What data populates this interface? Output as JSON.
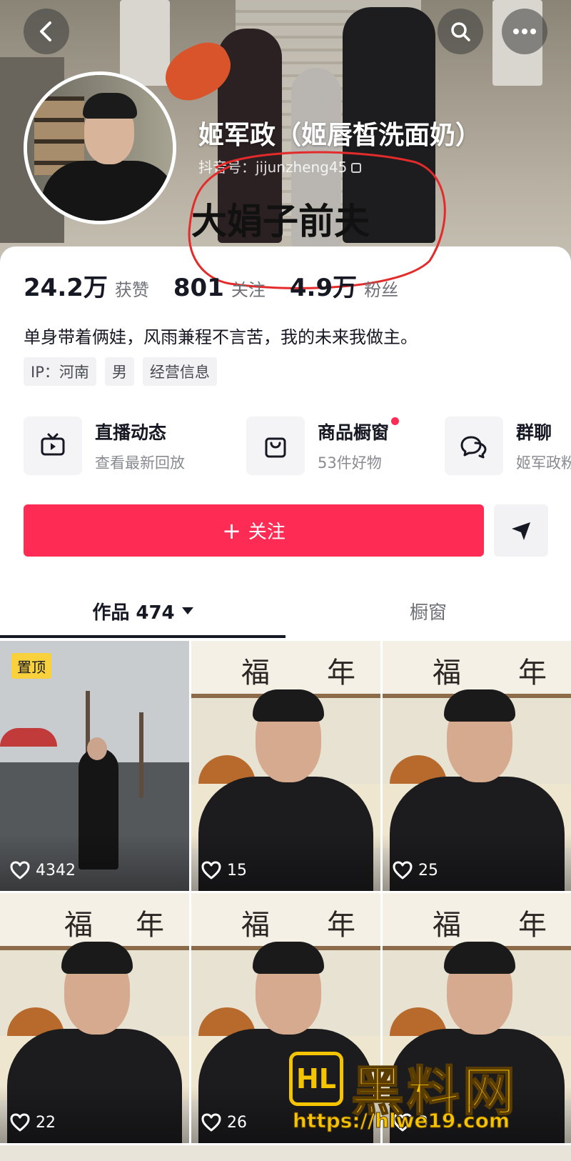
{
  "header": {
    "back_icon": "chevron-left-icon",
    "search_icon": "search-icon",
    "more_icon": "more-horizontal-icon",
    "username": "姬军政（姬唇皙洗面奶）",
    "douyin_id": "抖音号：jijunzheng45",
    "overlay_note": "大娟子前夫",
    "annotation_color": "#e32b2b"
  },
  "stats": [
    {
      "value": "24.2万",
      "label": "获赞"
    },
    {
      "value": "801",
      "label": "关注"
    },
    {
      "value": "4.9万",
      "label": "粉丝"
    }
  ],
  "bio": "单身带着俩娃，风雨兼程不言苦，我的未来我做主。",
  "tags": [
    "IP：河南",
    "男",
    "经营信息"
  ],
  "features": [
    {
      "title": "直播动态",
      "subtitle": "查看最新回放",
      "icon": "tv-play-icon"
    },
    {
      "title": "商品橱窗",
      "subtitle": "53件好物",
      "icon": "shopping-bag-icon",
      "badge": "red-dot"
    },
    {
      "title": "群聊",
      "subtitle": "姬军政粉",
      "icon": "chat-bubbles-icon"
    }
  ],
  "actions": {
    "follow_plus": "+",
    "follow_label": "关注",
    "share_icon": "send-arrow-icon",
    "accent_color": "#fe2c55"
  },
  "tabs": {
    "works": "作品 474",
    "showcase": "橱窗"
  },
  "videos": [
    {
      "likes": "4342",
      "pinned": "置顶"
    },
    {
      "likes": "15"
    },
    {
      "likes": "25"
    },
    {
      "likes": "22"
    },
    {
      "likes": "26"
    },
    {
      "likes": "3"
    }
  ],
  "calligraphy": [
    "福",
    "年",
    "福"
  ],
  "watermark": {
    "badge": "HL",
    "title": "黑料网",
    "url": "https://hlwe19.com"
  }
}
